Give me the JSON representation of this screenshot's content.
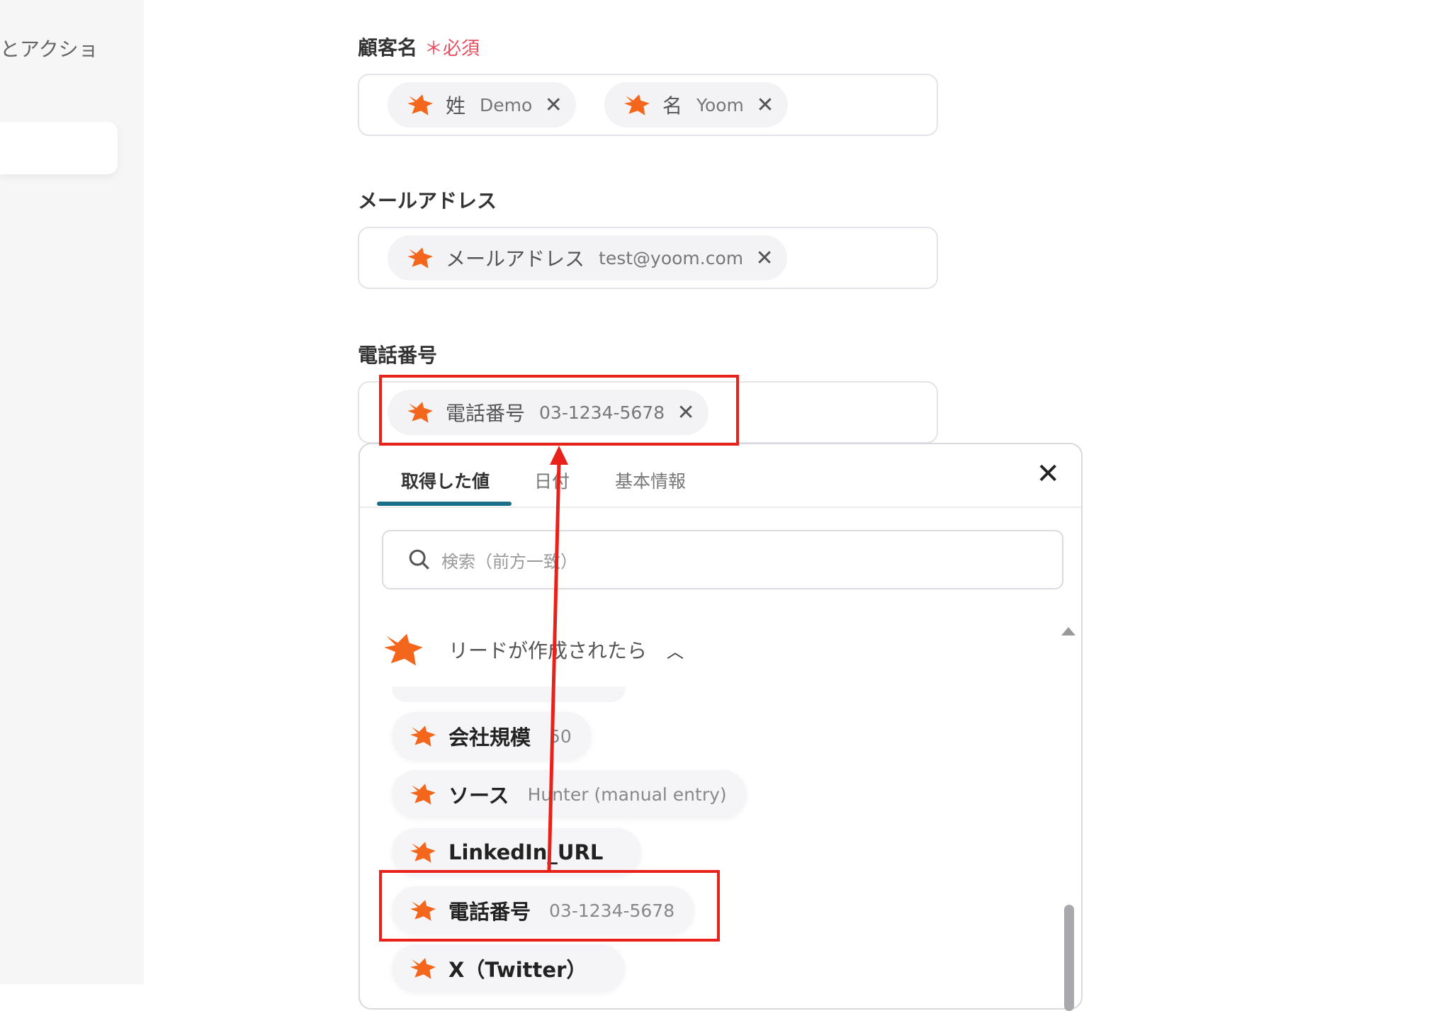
{
  "sidebar": {
    "partial_label": "とアクショ"
  },
  "fields": [
    {
      "label": "顧客名",
      "required": "＊必須",
      "chips": [
        {
          "name": "姓",
          "value": "Demo"
        },
        {
          "name": "名",
          "value": "Yoom"
        }
      ]
    },
    {
      "label": "メールアドレス",
      "chips": [
        {
          "name": "メールアドレス",
          "value": "test@yoom.com"
        }
      ]
    },
    {
      "label": "電話番号",
      "chips": [
        {
          "name": "電話番号",
          "value": "03-1234-5678"
        }
      ]
    }
  ],
  "chip_remove_icon": "✕",
  "panel": {
    "tabs": [
      "取得した値",
      "日付",
      "基本情報"
    ],
    "active_tab": "取得した値",
    "close_icon": "✕",
    "search_placeholder": "検索（前方一致）",
    "group_title": "リードが作成されたら",
    "group_toggle_icon": "︿",
    "items": [
      {
        "name": "会社規模",
        "value": "50"
      },
      {
        "name": "ソース",
        "value": "Hunter (manual entry)"
      },
      {
        "name": "LinkedIn_URL",
        "value": ""
      },
      {
        "name": "電話番号",
        "value": "03-1234-5678"
      },
      {
        "name": "X（Twitter）",
        "value": ""
      }
    ]
  },
  "colors": {
    "accent": "#1b6e87",
    "fox": "#f4661b",
    "highlight": "#e8221b",
    "required": "#e9505f"
  }
}
